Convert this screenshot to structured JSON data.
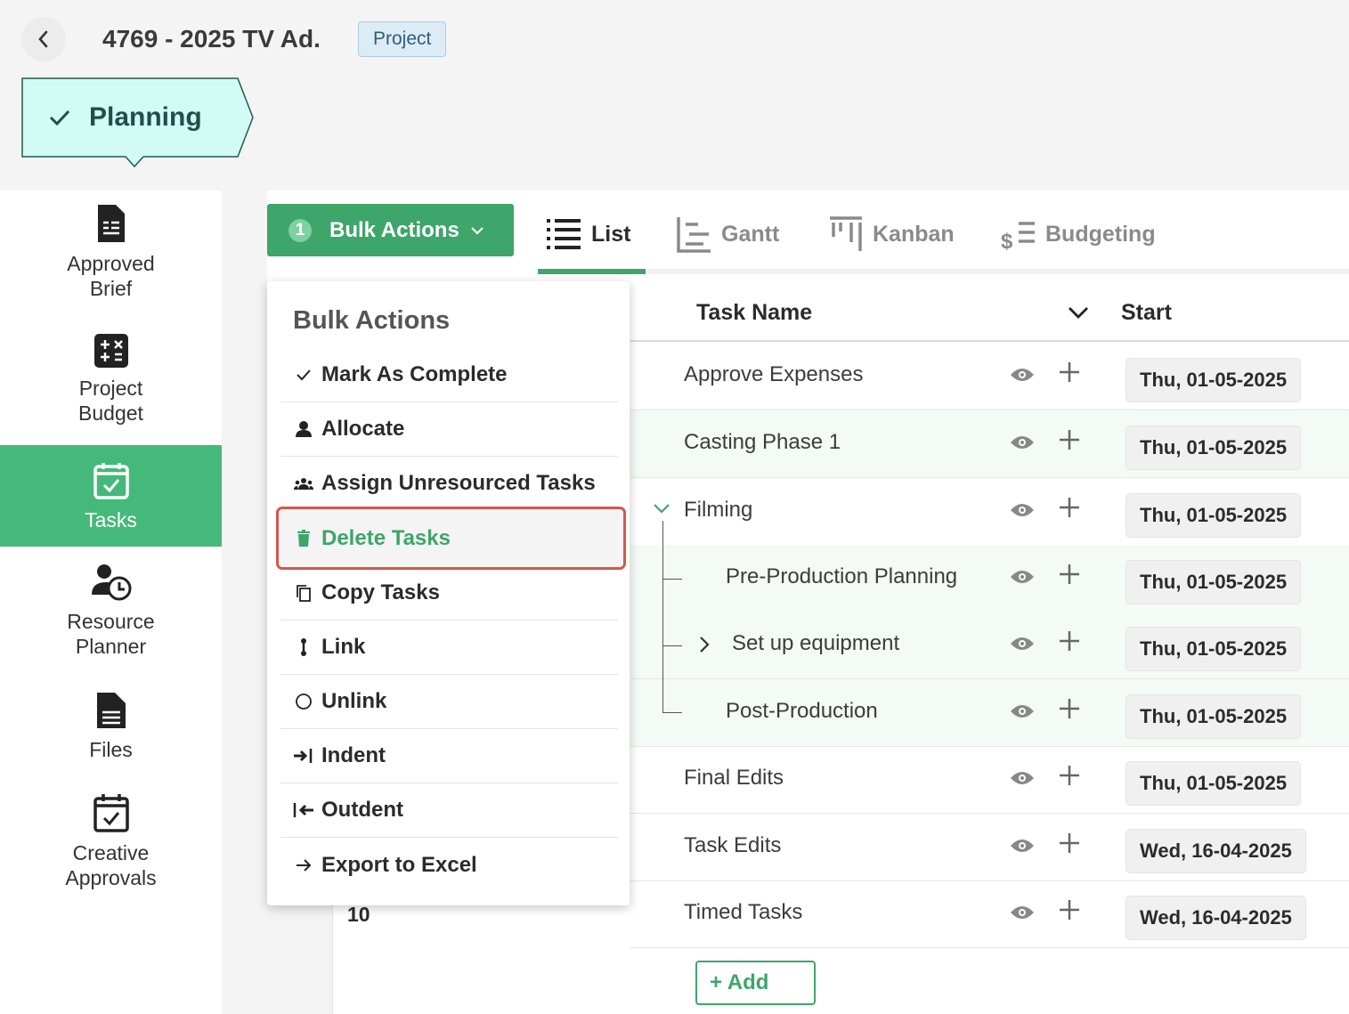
{
  "header": {
    "title": "4769 - 2025 TV Ad.",
    "badge": "Project",
    "stage": "Planning"
  },
  "sidebar": {
    "items": [
      {
        "label": "Approved\nBrief",
        "icon": "brief-document-icon",
        "active": false
      },
      {
        "label": "Project\nBudget",
        "icon": "calculator-icon",
        "active": false
      },
      {
        "label": "Tasks",
        "icon": "calendar-check-icon",
        "active": true
      },
      {
        "label": "Resource\nPlanner",
        "icon": "user-clock-icon",
        "active": false
      },
      {
        "label": "Files",
        "icon": "file-icon",
        "active": false
      },
      {
        "label": "Creative\nApprovals",
        "icon": "calendar-check-icon",
        "active": false
      }
    ]
  },
  "toolbar": {
    "bulk_count": "1",
    "bulk_label": "Bulk Actions",
    "tabs": [
      {
        "label": "List",
        "active": true
      },
      {
        "label": "Gantt",
        "active": false
      },
      {
        "label": "Kanban",
        "active": false
      },
      {
        "label": "Budgeting",
        "active": false
      }
    ]
  },
  "table": {
    "columns": [
      "Task Name",
      "Start"
    ],
    "rows": [
      {
        "name": "Approve Expenses",
        "start": "Thu, 01-05-2025"
      },
      {
        "name": "Casting Phase 1",
        "start": "Thu, 01-05-2025"
      },
      {
        "name": "Filming",
        "start": "Thu, 01-05-2025"
      },
      {
        "name": "Pre-Production Planning",
        "start": "Thu, 01-05-2025"
      },
      {
        "name": "Set up equipment",
        "start": "Thu, 01-05-2025"
      },
      {
        "name": "Post-Production",
        "start": "Thu, 01-05-2025"
      },
      {
        "name": "Final Edits",
        "start": "Thu, 01-05-2025"
      },
      {
        "name": "Task Edits",
        "start": "Wed, 16-04-2025"
      },
      {
        "name": "Timed Tasks",
        "start": "Wed, 16-04-2025"
      }
    ],
    "last_row_number": "10",
    "add_label": "+ Add"
  },
  "dropdown": {
    "title": "Bulk Actions",
    "items": [
      {
        "label": "Mark As Complete",
        "icon": "check-icon"
      },
      {
        "label": "Allocate",
        "icon": "user-icon"
      },
      {
        "label": "Assign Unresourced Tasks",
        "icon": "users-icon"
      },
      {
        "label": "Delete Tasks",
        "icon": "trash-icon"
      },
      {
        "label": "Copy Tasks",
        "icon": "copy-icon"
      },
      {
        "label": "Link",
        "icon": "link-icon"
      },
      {
        "label": "Unlink",
        "icon": "circle-icon"
      },
      {
        "label": "Indent",
        "icon": "indent-icon"
      },
      {
        "label": "Outdent",
        "icon": "outdent-icon"
      },
      {
        "label": "Export to Excel",
        "icon": "arrow-right-icon"
      }
    ]
  },
  "colors": {
    "accent": "#3ea56b",
    "active_nav": "#45b97a",
    "stage_fill": "#d3fbf5",
    "highlight_border": "#d5574a"
  }
}
